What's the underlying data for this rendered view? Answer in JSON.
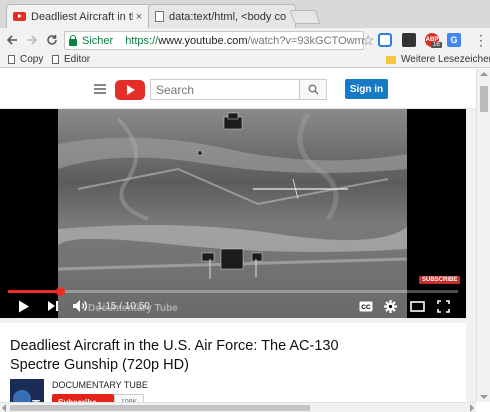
{
  "browser": {
    "tabs": [
      {
        "title": "Deadliest Aircraft in the U",
        "icon": "youtube-favicon",
        "active": true
      },
      {
        "title": "data:text/html, <body co",
        "icon": "document-favicon",
        "active": false
      }
    ],
    "close_glyph": "×",
    "omnibox": {
      "security_label": "Sicher",
      "url_scheme": "https://",
      "url_host": "www.youtube.com",
      "url_rest": "/watch?v=93kGCTOwm"
    },
    "extensions": [
      {
        "name": "extension-icon-1",
        "color": "#2f7de1"
      },
      {
        "name": "extension-icon-2",
        "color": "#333333"
      },
      {
        "name": "adblock-icon",
        "color": "#d93025",
        "badge": "ABP",
        "count": "16"
      },
      {
        "name": "translate-icon",
        "color": "#4285f4"
      }
    ],
    "menu_glyph": "⋮",
    "bookmarks": [
      {
        "label": "Copy",
        "icon": "page-icon"
      },
      {
        "label": "Editor",
        "icon": "page-icon"
      }
    ],
    "other_bookmarks": "Weitere Lesezeichen"
  },
  "youtube": {
    "search_placeholder": "Search",
    "signin_label": "Sign in",
    "player": {
      "current_time": "1:15",
      "duration": "10:50",
      "time_text": "1:15 / 10:50",
      "progress": 0.115,
      "subscribe_badge": "SUBSCRIBE",
      "watermark": "Documentary Tube"
    },
    "video": {
      "title": "Deadliest Aircraft in the U.S. Air Force: The AC-130 Spectre Gunship (720p HD)",
      "channel": "DOCUMENTARY TUBE",
      "subscribe_label": "Subscribe",
      "subscriber_count": "109K"
    }
  },
  "colors": {
    "brand_red": "#e52d27",
    "signin_blue": "#167ac6",
    "secure_green": "#0b8043"
  }
}
